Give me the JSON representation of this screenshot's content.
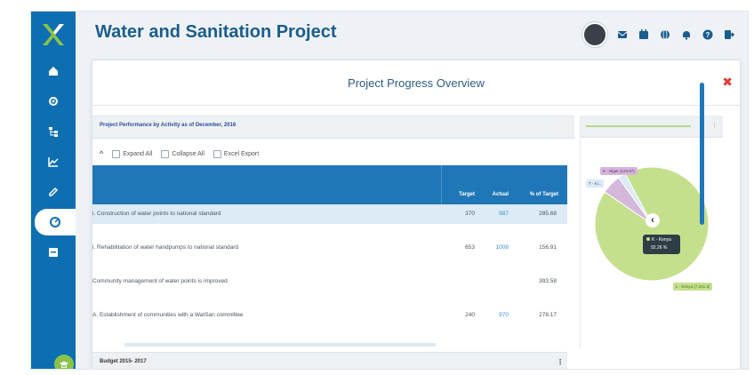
{
  "header": {
    "title": "Water and Sanitation Project"
  },
  "modal": {
    "title": "Project Progress Overview",
    "close_label": "✖"
  },
  "left_panel": {
    "heading": "Project Performance by Activity as of December, 2016",
    "toolbar": {
      "expand": "Expand All",
      "collapse": "Collapse All",
      "export": "Excel Export"
    },
    "columns": [
      "Target",
      "Actual",
      "% of Target"
    ],
    "rows": [
      {
        "label": "i. Construction of water points to national standard",
        "target": "370",
        "actual": "987",
        "pct": "285.68"
      },
      {
        "label": "i. Rehabilitation of water handpumps to national standard",
        "target": "653",
        "actual": "1008",
        "pct": "156.91"
      },
      {
        "label": "Community management of water points is improved",
        "target": "",
        "actual": "",
        "pct": "393.58"
      },
      {
        "label": "A. Establishment of communities with a WatSan committee",
        "target": "240",
        "actual": "970",
        "pct": "278.17"
      }
    ]
  },
  "budget": {
    "label": "Budget 2015- 2017",
    "more": "⋮"
  },
  "pie": {
    "labels": {
      "niger": "K - Niger (123.97)",
      "ki": "T - Ki...",
      "kenya": "L - Kenya (7,241.3)"
    },
    "tooltip": {
      "line1": "K - Kenya",
      "line2": "92.26 %"
    },
    "back": "‹"
  },
  "chart_data": {
    "type": "pie",
    "slices": [
      {
        "name": "K - Kenya",
        "value": 92.26,
        "color": "#c4e08d"
      },
      {
        "name": "K - Niger",
        "value": 5.6,
        "color": "#d6b7dc"
      },
      {
        "name": "T - Ki...",
        "value": 2.14,
        "color": "#dce9f6"
      }
    ],
    "title": ""
  }
}
